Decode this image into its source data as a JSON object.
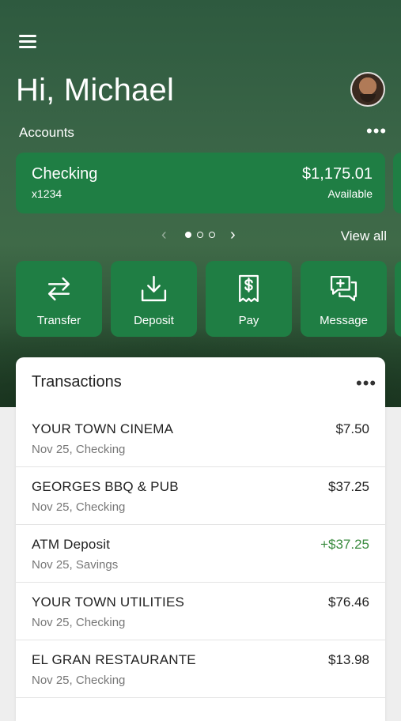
{
  "greeting": "Hi, Michael",
  "accounts": {
    "label": "Accounts",
    "more_icon": "more-horizontal-icon",
    "card": {
      "name": "Checking",
      "number": "x1234",
      "balance": "$1,175.01",
      "balance_label": "Available"
    },
    "pager": {
      "count": 3,
      "active_index": 0
    },
    "view_all": "View all"
  },
  "actions": [
    {
      "label": "Transfer",
      "icon": "transfer-icon"
    },
    {
      "label": "Deposit",
      "icon": "deposit-icon"
    },
    {
      "label": "Pay",
      "icon": "pay-bill-icon"
    },
    {
      "label": "Message",
      "icon": "message-icon"
    }
  ],
  "transactions": {
    "title": "Transactions",
    "items": [
      {
        "merchant": "YOUR TOWN CINEMA",
        "detail": "Nov 25, Checking",
        "amount": "$7.50",
        "credit": false
      },
      {
        "merchant": "GEORGES BBQ & PUB",
        "detail": "Nov 25, Checking",
        "amount": "$37.25",
        "credit": false
      },
      {
        "merchant": "ATM Deposit",
        "detail": "Nov 25, Savings",
        "amount": "+$37.25",
        "credit": true
      },
      {
        "merchant": "YOUR TOWN UTILITIES",
        "detail": "Nov 25, Checking",
        "amount": "$76.46",
        "credit": false
      },
      {
        "merchant": "EL GRAN RESTAURANTE",
        "detail": "Nov 25, Checking",
        "amount": "$13.98",
        "credit": false
      }
    ]
  },
  "colors": {
    "brand_green": "#1f7e44",
    "credit_green": "#3a8b3f",
    "background": "#eeeeee"
  }
}
